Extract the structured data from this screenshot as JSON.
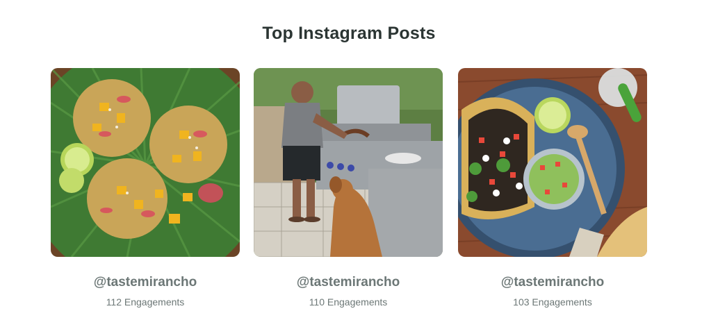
{
  "title": "Top Instagram Posts",
  "posts": [
    {
      "handle": "@tastemirancho",
      "engagements": "112 Engagements",
      "image": "tacos-on-green-plate"
    },
    {
      "handle": "@tastemirancho",
      "engagements": "110 Engagements",
      "image": "man-grilling-with-dog"
    },
    {
      "handle": "@tastemirancho",
      "engagements": "103 Engagements",
      "image": "tacos-with-salsa-bowl"
    }
  ]
}
